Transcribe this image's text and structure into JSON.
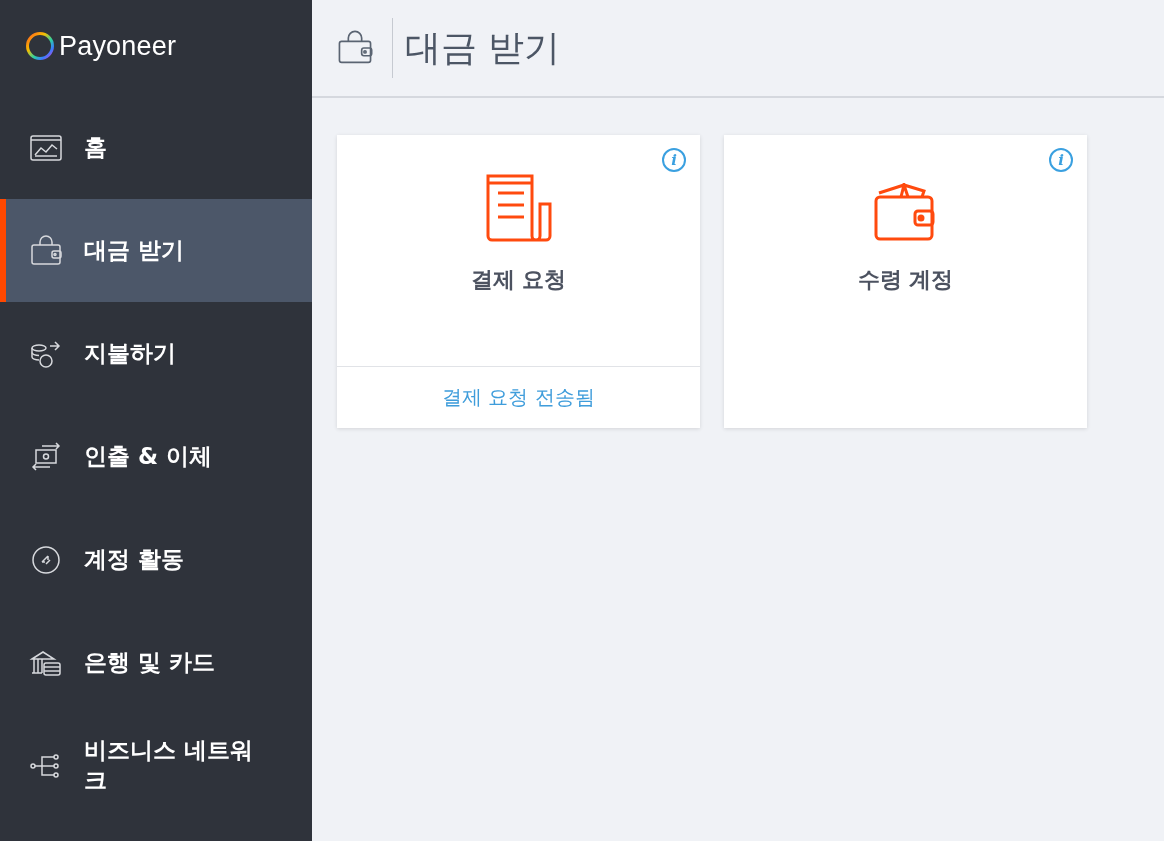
{
  "logo": {
    "text": "Payoneer"
  },
  "sidebar": {
    "items": [
      {
        "label": "홈",
        "selected": false
      },
      {
        "label": "대금 받기",
        "selected": true
      },
      {
        "label": "지불하기",
        "selected": false
      },
      {
        "label": "인출 & 이체",
        "selected": false
      },
      {
        "label": "계정 활동",
        "selected": false
      },
      {
        "label": "은행 및 카드",
        "selected": false
      },
      {
        "label": "비즈니스 네트워크",
        "selected": false
      }
    ]
  },
  "header": {
    "title": "대금 받기"
  },
  "cards": [
    {
      "title": "결제 요청",
      "info": "i",
      "link": "결제 요청 전송됨"
    },
    {
      "title": "수령 계정",
      "info": "i"
    }
  ]
}
